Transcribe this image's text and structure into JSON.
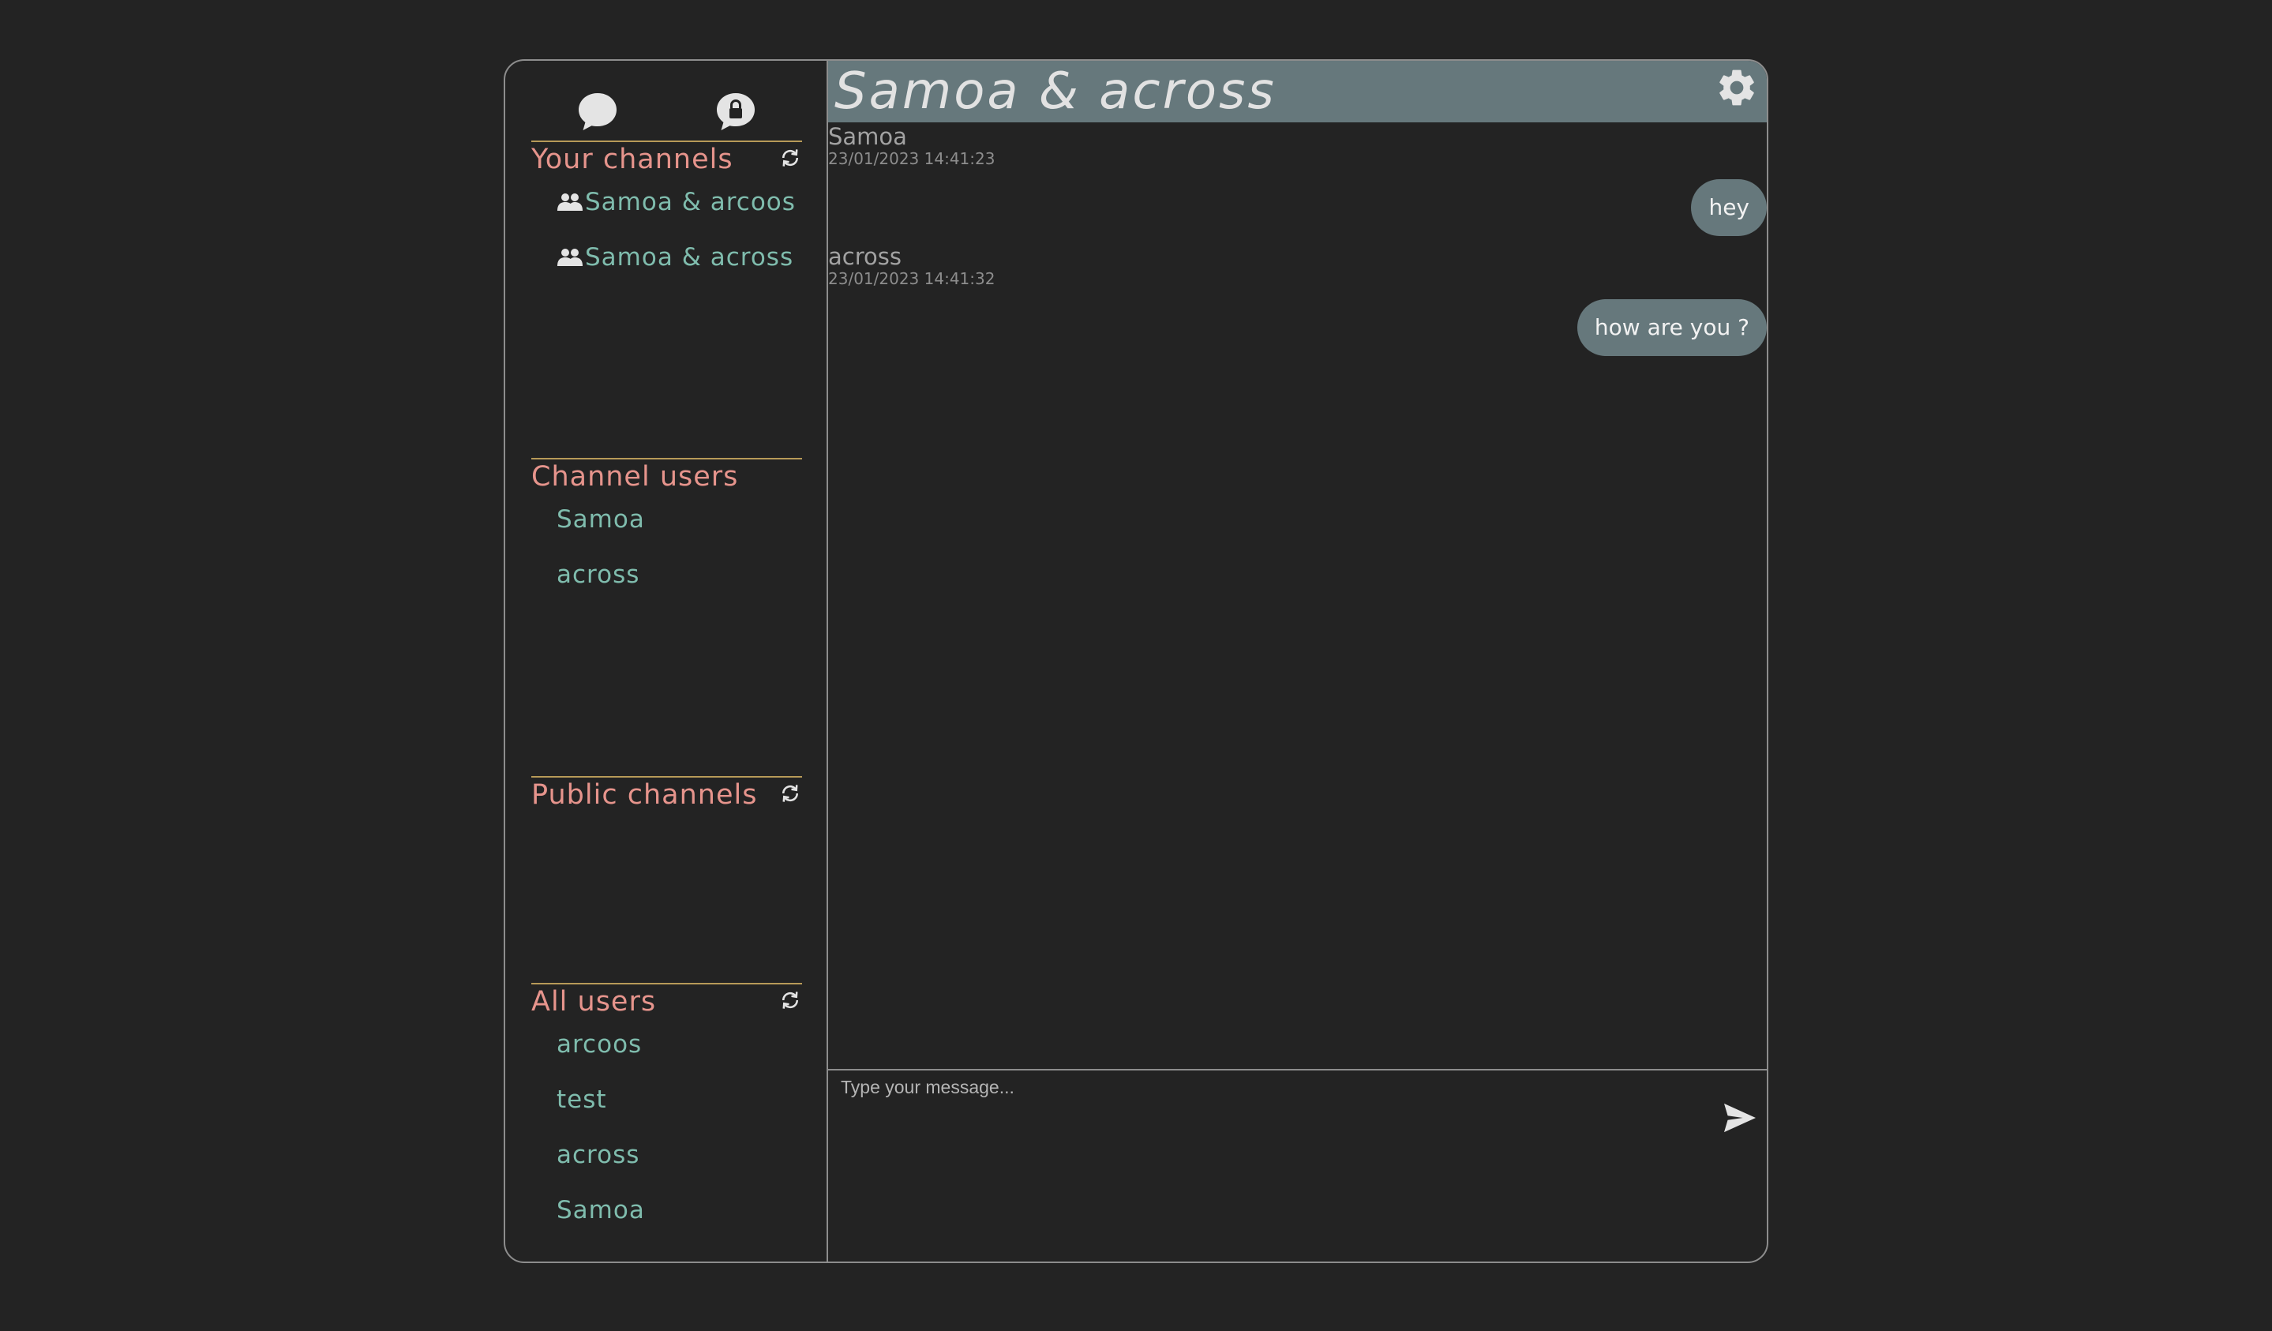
{
  "sidebar": {
    "your_channels": {
      "title": "Your channels",
      "items": [
        {
          "label": "Samoa & arcoos"
        },
        {
          "label": "Samoa & across"
        }
      ]
    },
    "channel_users": {
      "title": "Channel users",
      "items": [
        {
          "label": "Samoa"
        },
        {
          "label": "across"
        }
      ]
    },
    "public_channels": {
      "title": "Public channels",
      "items": []
    },
    "all_users": {
      "title": "All users",
      "items": [
        {
          "label": "arcoos"
        },
        {
          "label": "test"
        },
        {
          "label": "across"
        },
        {
          "label": "Samoa"
        }
      ]
    }
  },
  "chat": {
    "title": "Samoa & across",
    "messages": [
      {
        "author": "Samoa",
        "time": "23/01/2023 14:41:23",
        "text": "hey"
      },
      {
        "author": "across",
        "time": "23/01/2023 14:41:32",
        "text": "how are you ?"
      }
    ],
    "composer": {
      "placeholder": "Type your message..."
    }
  },
  "icons": {
    "chat_nav": "chat-bubble-icon",
    "private_nav": "lock-chat-icon",
    "refresh": "refresh-icon",
    "group": "group-icon",
    "settings": "gear-icon",
    "send": "send-icon"
  },
  "colors": {
    "background": "#232323",
    "border": "#8d8d8d",
    "section_title": "#e6948c",
    "section_rule": "#b79a58",
    "item_text": "#7fbcad",
    "header_bg": "#66787c",
    "bubble_bg": "#66787c"
  }
}
